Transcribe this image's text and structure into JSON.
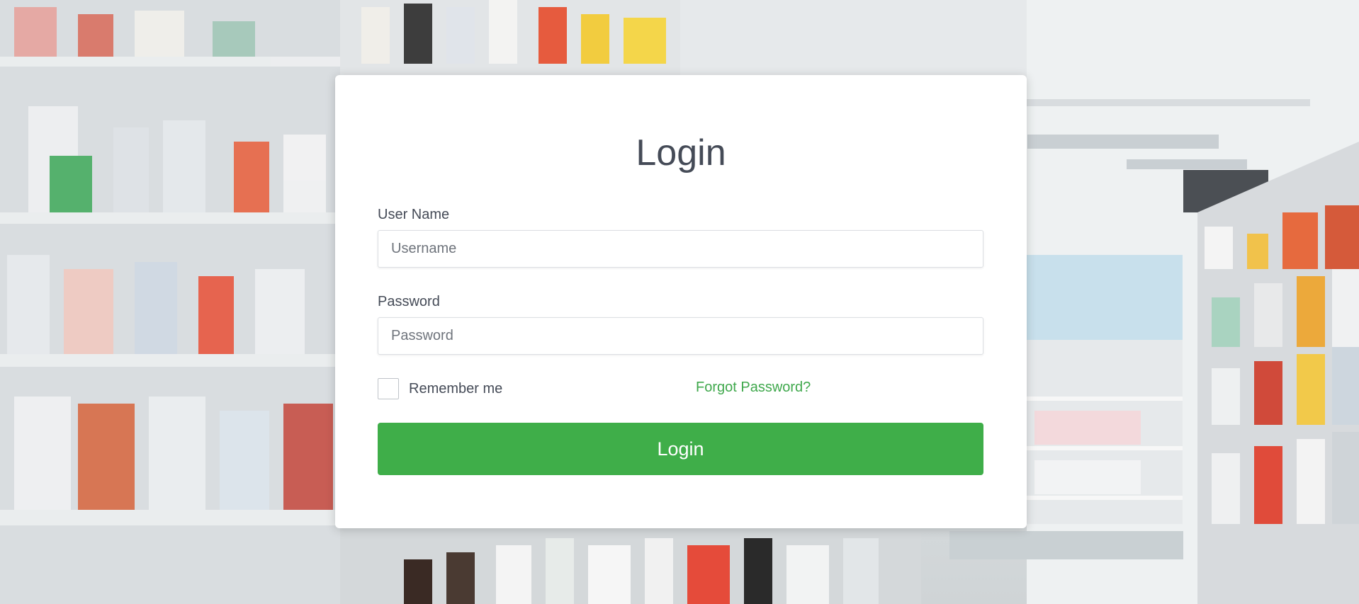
{
  "login": {
    "title": "Login",
    "username": {
      "label": "User Name",
      "placeholder": "Username",
      "value": ""
    },
    "password": {
      "label": "Password",
      "placeholder": "Password",
      "value": ""
    },
    "remember_label": "Remember me",
    "forgot_label": "Forgot Password?",
    "submit_label": "Login"
  },
  "colors": {
    "accent_green": "#3fae49",
    "link_green": "#3fa84c",
    "text_dark": "#454b57",
    "card_bg": "#ffffff"
  }
}
